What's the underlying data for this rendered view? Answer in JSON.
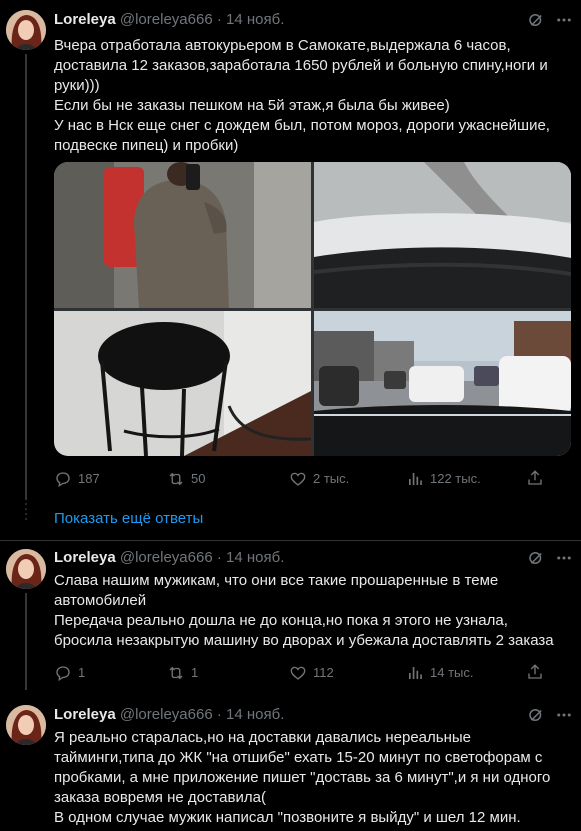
{
  "posts": [
    {
      "author": "Loreleya",
      "handle": "@loreleya666",
      "separator": "·",
      "date": "14 нояб.",
      "paragraphs": [
        "Вчера отработала автокурьером в Самокате,выдержала 6 часов, доставила 12 заказов,заработала 1650 рублей и больную спину,ноги и руки)))",
        "Если бы не заказы пешком на 5й этаж,я была бы живее)",
        "У нас в Нск еще снег с дождем был, потом мороз, дороги ужаснейшие, подвеске пипец) и пробки)"
      ],
      "stats": {
        "replies": "187",
        "reposts": "50",
        "likes": "2 тыс.",
        "views": "122 тыс."
      }
    },
    {
      "author": "Loreleya",
      "handle": "@loreleya666",
      "separator": "·",
      "date": "14 нояб.",
      "paragraphs": [
        "Слава нашим мужикам, что они все такие прошаренные в теме автомобилей",
        "Передача реально дошла не до конца,но пока я этого не узнала, бросила незакрытую машину во дворах и убежала доставлять 2 заказа"
      ],
      "stats": {
        "replies": "1",
        "reposts": "1",
        "likes": "112",
        "views": "14 тыс."
      }
    },
    {
      "author": "Loreleya",
      "handle": "@loreleya666",
      "separator": "·",
      "date": "14 нояб.",
      "paragraphs": [
        "Я реально старалась,но на доставки давались нереальные тайминги,типа до ЖК \"на отшибе\" ехать 15-20 минут по светофорам с пробками, а мне приложение пишет \"доставь за 6 минут\",и я ни одного заказа вовремя не доставила(",
        "В одном случае мужик написал \"позвоните я выйду\" и шел 12 мин."
      ]
    }
  ],
  "show_more_label": "Показать ещё ответы",
  "icons": {
    "reply": "reply-icon",
    "repost": "repost-icon",
    "like": "heart-icon",
    "views": "views-icon",
    "share": "share-icon",
    "grok": "grok-icon",
    "more": "more-icon"
  },
  "colors": {
    "background": "#000000",
    "text": "#e7e9ea",
    "muted": "#71767b",
    "link": "#1d9bf0",
    "border": "#2f3336"
  }
}
